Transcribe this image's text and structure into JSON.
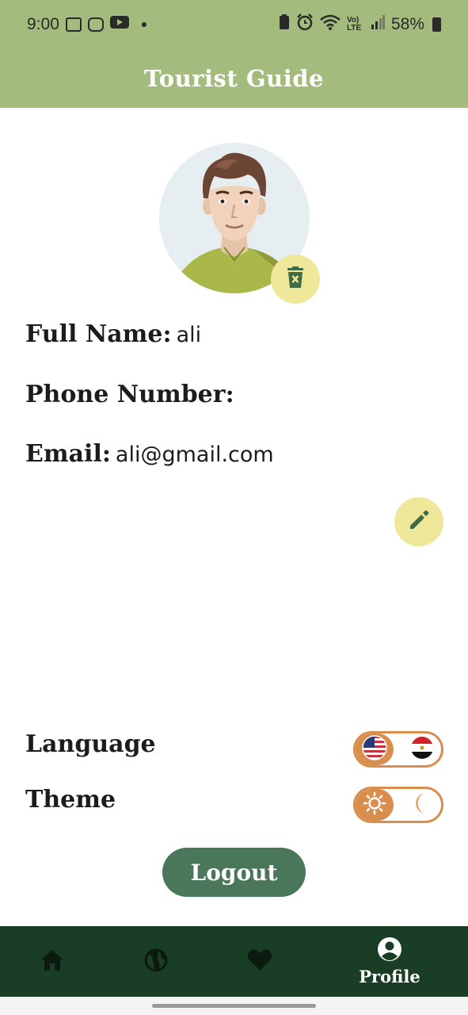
{
  "status_bar": {
    "time": "9:00",
    "battery": "58%",
    "volte": "Vo) LTE"
  },
  "app_bar": {
    "title": "Tourist Guide"
  },
  "profile": {
    "full_name_label": "Full Name:",
    "full_name_value": "ali",
    "phone_label": "Phone Number:",
    "phone_value": "",
    "email_label": "Email:",
    "email_value": "ali@gmail.com"
  },
  "settings": {
    "language_label": "Language",
    "theme_label": "Theme",
    "language_selected": "english",
    "theme_selected": "light"
  },
  "logout_label": "Logout",
  "bottom_nav": {
    "items": [
      {
        "icon": "home-icon",
        "label": ""
      },
      {
        "icon": "globe-icon",
        "label": ""
      },
      {
        "icon": "heart-icon",
        "label": ""
      },
      {
        "icon": "account-circle-icon",
        "label": "Profile"
      }
    ],
    "active_index": 3
  },
  "colors": {
    "app_bar": "#a3bb7c",
    "accent_yellow": "#efe79a",
    "toggle_orange": "#d98e4e",
    "logout_green": "#4a7659",
    "nav_bg": "#1a3e25"
  }
}
